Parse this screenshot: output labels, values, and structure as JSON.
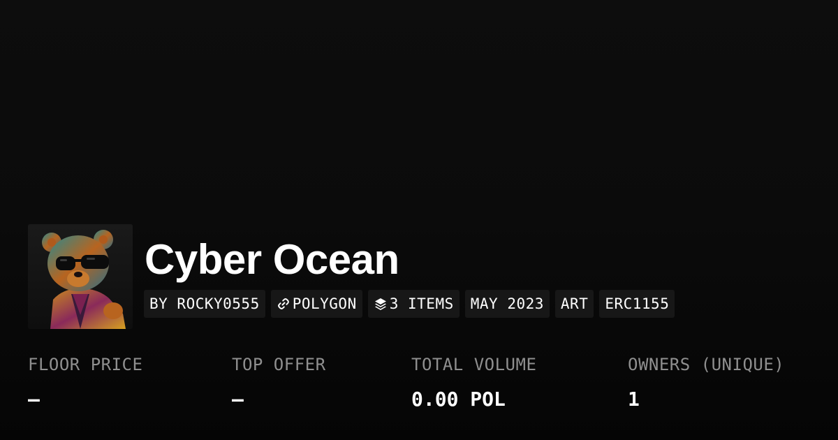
{
  "collection": {
    "title": "Cyber Ocean",
    "avatar_icon": "bear-with-sunglasses-avatar"
  },
  "tags": [
    {
      "label": "BY ROCKY0555",
      "icon": null
    },
    {
      "label": "POLYGON",
      "icon": "chain-link-icon"
    },
    {
      "label": "3 ITEMS",
      "icon": "layers-icon"
    },
    {
      "label": "MAY 2023",
      "icon": null
    },
    {
      "label": "ART",
      "icon": null
    },
    {
      "label": "ERC1155",
      "icon": null
    }
  ],
  "stats": [
    {
      "label": "FLOOR PRICE",
      "value": "–"
    },
    {
      "label": "TOP OFFER",
      "value": "–"
    },
    {
      "label": "TOTAL VOLUME",
      "value": "0.00 POL"
    },
    {
      "label": "OWNERS (UNIQUE)",
      "value": "1"
    }
  ],
  "colors": {
    "background": "#0a0a0a",
    "tag_background": "#171717",
    "label_gray": "#8f8f8f",
    "text": "#ffffff"
  }
}
